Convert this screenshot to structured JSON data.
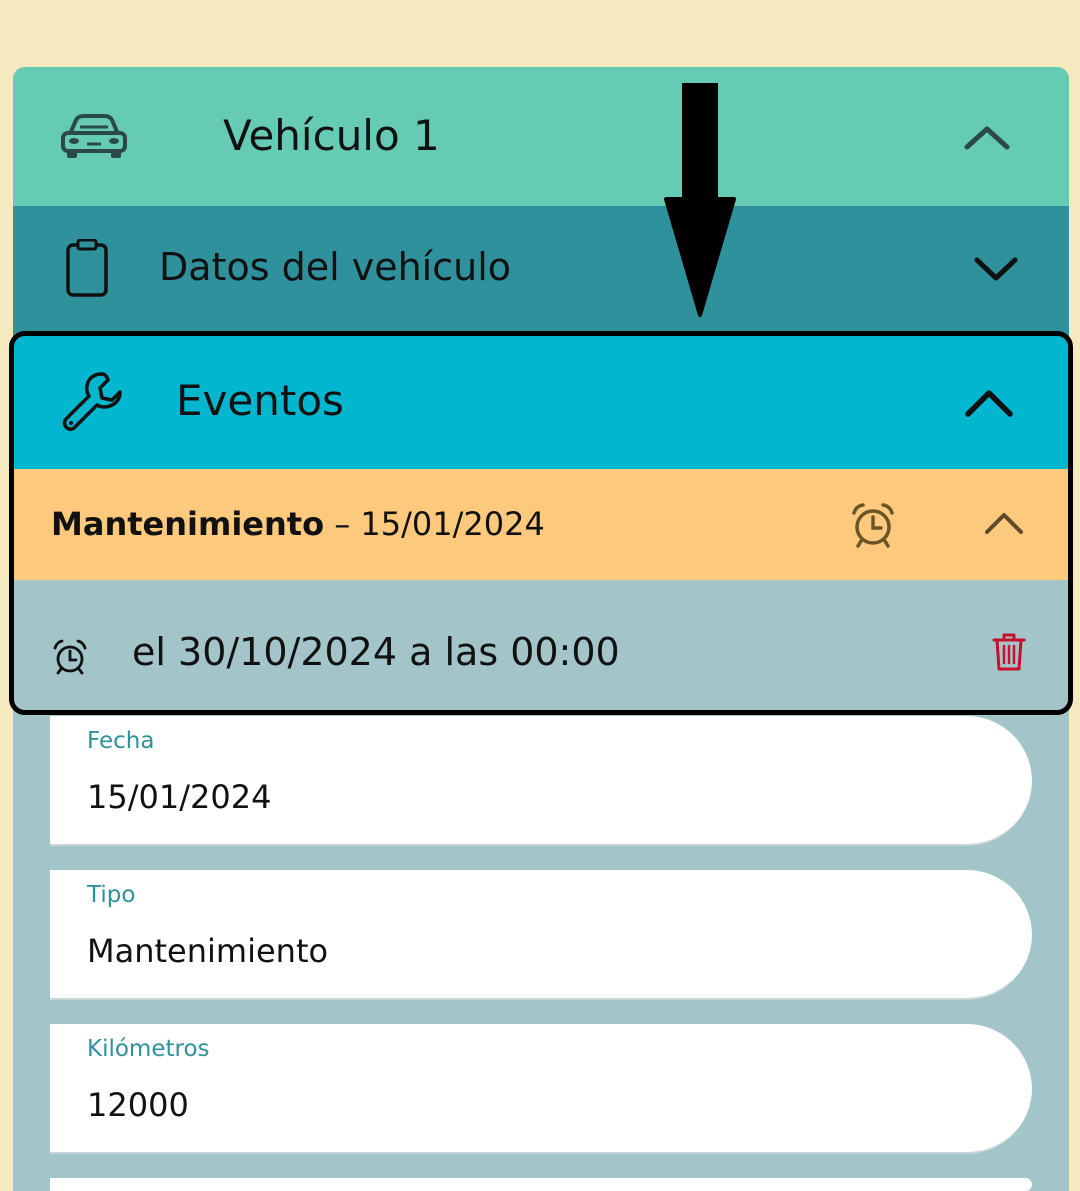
{
  "vehicle": {
    "title": "Vehículo 1",
    "icon": "car-icon"
  },
  "sections": {
    "datos": {
      "title": "Datos del vehículo",
      "icon": "clipboard-icon"
    },
    "eventos": {
      "title": "Eventos",
      "icon": "wrench-icon"
    }
  },
  "event": {
    "type": "Mantenimiento",
    "separator": " – ",
    "date": "15/01/2024",
    "reminder_text": "el 30/10/2024 a las 00:00"
  },
  "fields": [
    {
      "label": "Fecha",
      "value": " 15/01/2024"
    },
    {
      "label": "Tipo",
      "value": "Mantenimiento"
    },
    {
      "label": "Kilómetros",
      "value": "12000"
    }
  ],
  "colors": {
    "background": "#f5e9c0",
    "vehicle_header": "#66cbb4",
    "datos_header": "#2e919c",
    "eventos_header": "#00b7cf",
    "event_header": "#fdca7d",
    "panel": "#a3c4c9",
    "label": "#2e919c",
    "delete": "#c8102e"
  }
}
